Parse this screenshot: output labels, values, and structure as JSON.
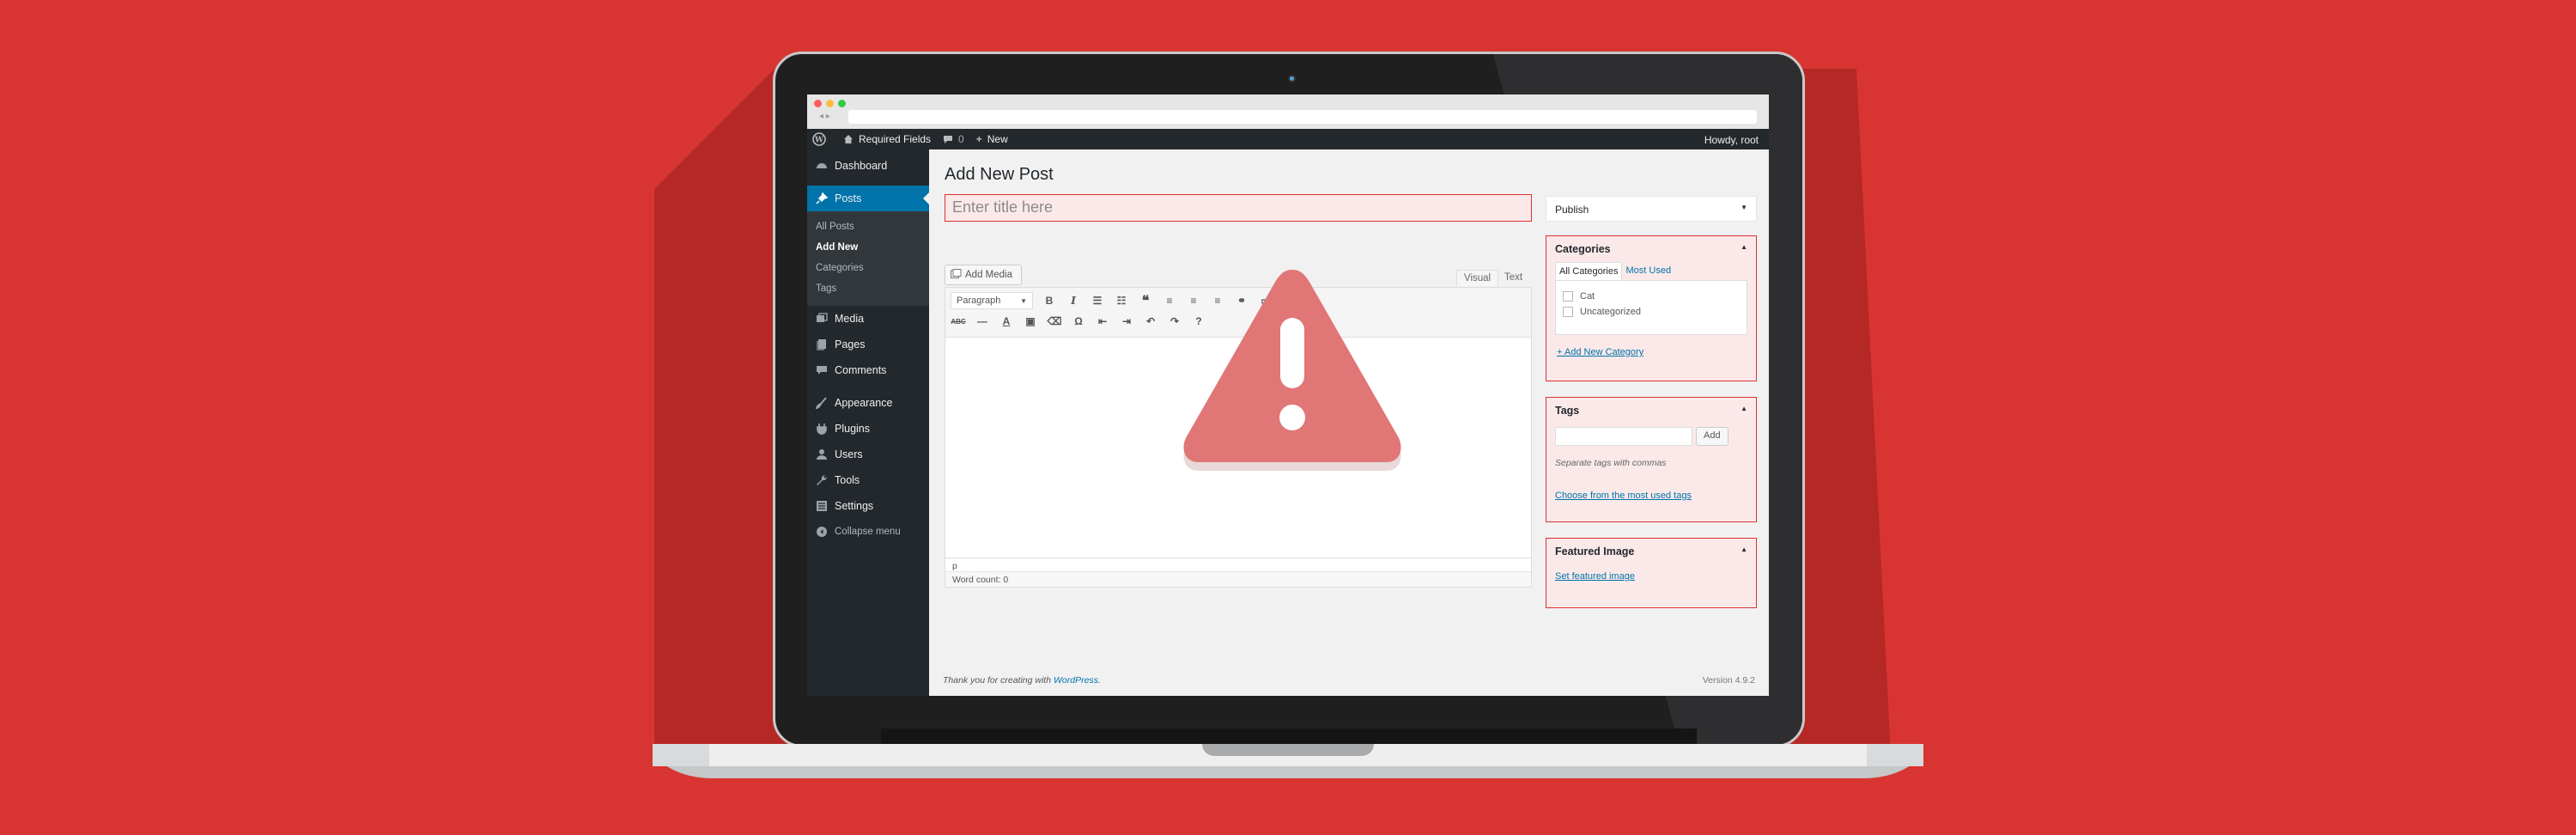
{
  "colors": {
    "background": "#d83532",
    "accent": "#0073aa",
    "error": "#dc3232",
    "admin_dark": "#23282d"
  },
  "adminbar": {
    "site_name": "Required Fields",
    "comments_count": "0",
    "new_label": "New",
    "howdy": "Howdy, root"
  },
  "sidebar": {
    "items": [
      {
        "label": "Dashboard",
        "icon": "dashboard-icon"
      },
      {
        "label": "Posts",
        "icon": "pin-icon"
      },
      {
        "label": "Media",
        "icon": "media-icon"
      },
      {
        "label": "Pages",
        "icon": "pages-icon"
      },
      {
        "label": "Comments",
        "icon": "comments-icon"
      },
      {
        "label": "Appearance",
        "icon": "brush-icon"
      },
      {
        "label": "Plugins",
        "icon": "plugin-icon"
      },
      {
        "label": "Users",
        "icon": "users-icon"
      },
      {
        "label": "Tools",
        "icon": "wrench-icon"
      },
      {
        "label": "Settings",
        "icon": "settings-icon"
      }
    ],
    "posts_submenu": [
      "All Posts",
      "Add New",
      "Categories",
      "Tags"
    ],
    "collapse": "Collapse menu"
  },
  "editor": {
    "page_title": "Add New Post",
    "title_placeholder": "Enter title here",
    "add_media": "Add Media",
    "tab_visual": "Visual",
    "tab_text": "Text",
    "format_select": "Paragraph",
    "path": "p",
    "word_count": "Word count: 0"
  },
  "metaboxes": {
    "publish": "Publish",
    "categories": {
      "title": "Categories",
      "tab_all": "All Categories",
      "tab_most": "Most Used",
      "items": [
        "Cat",
        "Uncategorized"
      ],
      "add_new": "+ Add New Category"
    },
    "tags": {
      "title": "Tags",
      "add_button": "Add",
      "hint": "Separate tags with commas",
      "choose": "Choose from the most used tags"
    },
    "featured": {
      "title": "Featured Image",
      "set_link": "Set featured image"
    }
  },
  "footer": {
    "thanks_prefix": "Thank you for creating with ",
    "thanks_link": "WordPress",
    "thanks_suffix": ".",
    "version": "Version 4.9.2"
  }
}
